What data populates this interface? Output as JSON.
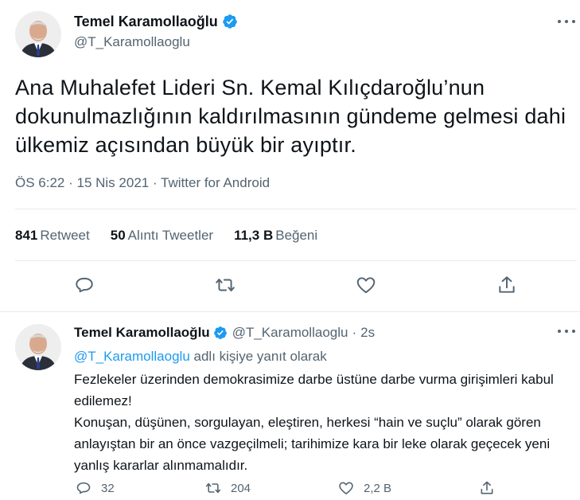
{
  "main_tweet": {
    "author_name": "Temel Karamollaoğlu",
    "handle": "@T_Karamollaoglu",
    "text": "Ana Muhalefet Lideri Sn. Kemal Kılıçdaroğlu’nun dokunulmazlığının kaldırılmasının gündeme gelmesi dahi ülkemiz açısından büyük bir ayıptır.",
    "time": "ÖS 6:22",
    "date": "15 Nis 2021",
    "source": "Twitter for Android",
    "stats": {
      "retweets_count": "841",
      "retweets_label": "Retweet",
      "quotes_count": "50",
      "quotes_label": "Alıntı Tweetler",
      "likes_count": "11,3 B",
      "likes_label": "Beğeni"
    },
    "actions": [
      "reply-icon",
      "retweet-icon",
      "like-icon",
      "share-icon"
    ]
  },
  "reply_tweet": {
    "author_name": "Temel Karamollaoğlu",
    "handle": "@T_Karamollaoglu",
    "separator": "·",
    "time": "2s",
    "replying_to_mention": "@T_Karamollaoglu",
    "replying_to_suffix": "adlı kişiye yanıt olarak",
    "text_line1": "Fezlekeler üzerinden demokrasimize darbe üstüne darbe vurma girişimleri kabul edilemez!",
    "text_line2": "Konuşan, düşünen, sorgulayan, eleştiren, herkesi “hain ve suçlu” olarak gören anlayıştan bir an önce vazgeçilmeli; tarihimize kara bir leke olarak geçecek yeni yanlış kararlar alınmamalıdır.",
    "reply_count": "32",
    "retweet_count": "204",
    "like_count": "2,2 B"
  },
  "colors": {
    "accent": "#1d9bf0",
    "text_primary": "#0f1419",
    "text_secondary": "#536471",
    "divider": "#e6ecf0"
  }
}
